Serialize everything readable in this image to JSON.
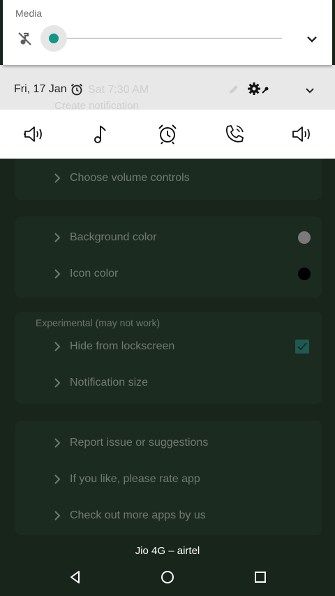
{
  "media_panel": {
    "title": "Media",
    "volume_level": 0.0
  },
  "status_strip": {
    "date": "Fri, 17 Jan",
    "next_alarm": "Sat 7:30 AM",
    "behind_text": "Create notification"
  },
  "volume_bar": {
    "icons": [
      "ringer-volume-icon",
      "music-note-icon",
      "alarm-clock-icon",
      "call-volume-icon",
      "speaker-volume-icon"
    ]
  },
  "app": {
    "row_choose_volume": "Choose volume controls",
    "row_background_color": "Background color",
    "background_color_value": "#7a7a7a",
    "row_icon_color": "Icon color",
    "icon_color_value": "#000000",
    "experimental_title": "Experimental (may not work)",
    "row_hide_lockscreen": "Hide from lockscreen",
    "hide_lockscreen_checked": true,
    "row_notification_size": "Notification size",
    "row_report_issue": "Report issue or suggestions",
    "row_rate_app": "If you like, please rate app",
    "row_more_apps": "Check out more apps by us"
  },
  "carrier": "Jio 4G – airtel",
  "colors": {
    "accent": "#13968a",
    "background": "#17251a",
    "card": "#1c2b1f"
  }
}
